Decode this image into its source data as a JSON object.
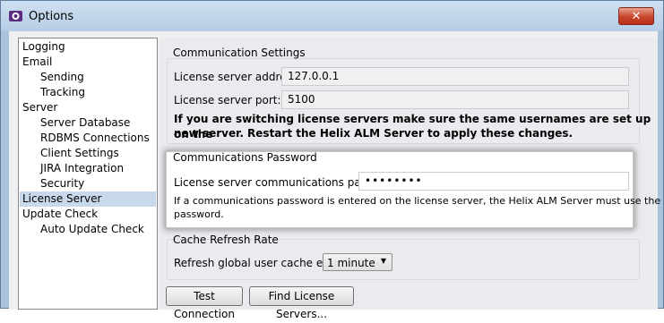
{
  "window": {
    "title": "Options",
    "close_glyph": "✕"
  },
  "sidebar": {
    "items": [
      {
        "label": "Logging",
        "indent": 0,
        "selected": false
      },
      {
        "label": "Email",
        "indent": 0,
        "selected": false
      },
      {
        "label": "Sending",
        "indent": 1,
        "selected": false
      },
      {
        "label": "Tracking",
        "indent": 1,
        "selected": false
      },
      {
        "label": "Server",
        "indent": 0,
        "selected": false
      },
      {
        "label": "Server Database",
        "indent": 1,
        "selected": false
      },
      {
        "label": "RDBMS Connections",
        "indent": 1,
        "selected": false
      },
      {
        "label": "Client Settings",
        "indent": 1,
        "selected": false
      },
      {
        "label": "JIRA Integration",
        "indent": 1,
        "selected": false
      },
      {
        "label": "Security",
        "indent": 1,
        "selected": false
      },
      {
        "label": "License Server",
        "indent": 0,
        "selected": true
      },
      {
        "label": "Update Check",
        "indent": 0,
        "selected": false
      },
      {
        "label": "Auto Update Check",
        "indent": 1,
        "selected": false
      }
    ]
  },
  "comm_settings": {
    "title": "Communication Settings",
    "address_label": "License server address:",
    "address_value": "127.0.0.1",
    "port_label": "License server port:",
    "port_value": "5100",
    "note_line1": "If you are switching license servers make sure the same usernames are set up on the",
    "note_line2": "new server. Restart the Helix ALM Server to apply these changes."
  },
  "comm_password": {
    "title": "Communications Password",
    "password_label": "License server communications password:",
    "password_value": "••••••••",
    "info_line1": "If a communications password is entered on the license server, the Helix ALM Server must use the same",
    "info_line2": "password."
  },
  "cache": {
    "title": "Cache Refresh Rate",
    "refresh_label": "Refresh global user cache every:",
    "refresh_value": "1 minute"
  },
  "buttons": {
    "test_connection": "Test Connection",
    "find_servers": "Find License Servers..."
  },
  "colors": {
    "selection": "#c8d9ec",
    "close_button": "#c9442b",
    "title_bar": "#b9d0e8"
  }
}
